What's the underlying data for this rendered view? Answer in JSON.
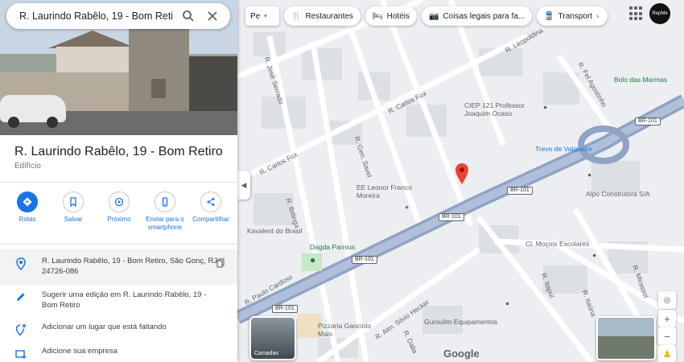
{
  "search": {
    "query": "R. Laurindo Rabêlo, 19 - Bom Retiro"
  },
  "place": {
    "title": "R. Laurindo Rabêlo, 19 - Bom Retiro",
    "category": "Edifício"
  },
  "actions": [
    {
      "label": "Rotas",
      "icon": "directions-icon"
    },
    {
      "label": "Salvar",
      "icon": "bookmark-icon"
    },
    {
      "label": "Próximo",
      "icon": "nearby-icon"
    },
    {
      "label": "Enviar para o smartphone",
      "icon": "send-to-phone-icon"
    },
    {
      "label": "Compartilhar",
      "icon": "share-icon"
    }
  ],
  "info": {
    "address": "R. Laurindo Rabêlo, 19 - Bom Retiro, São Gonç, RJ, 24726-086",
    "suggest_edit": "Sugerir uma edição em R. Laurindo Rabêlo, 19 - Bom Retiro",
    "add_place": "Adicionar um lugar que está faltando",
    "add_business": "Adicione sua empresa"
  },
  "chips": [
    "Pe",
    "Restaurantes",
    "Hotéis",
    "Coisas legais para fa...",
    "Transport"
  ],
  "map": {
    "layers_label": "Camadas",
    "logo": "Google",
    "streets": [
      "R. José Serrado",
      "R. Carlos Fox",
      "R. Gen. Savel",
      "R. Alm. Silvio Hecker",
      "R. Itapuí",
      "R. Itaúna",
      "R. Mirassol",
      "R. Fel Agostinho",
      "R. Ibitinga",
      "R. Dalia",
      "R. Paulo Cardoso",
      "R. Leopoldina"
    ],
    "pois": [
      "CIEP 121 Professor Joaquim Ocaso",
      "EE Leonor Franco Moreira",
      "Alpo Construtora S/A",
      "Dagda Parnius",
      "Cl. Moçois Escolares",
      "Pizzaria Ganciolo Mais",
      "Gurouilm Equipamentos",
      "Bolo das Marmas",
      "Kavalent do Brasil",
      "Trevo de Valqueire"
    ],
    "road_shields": [
      "BR-101",
      "BR-101",
      "BR-101",
      "BR-101",
      "BR-101"
    ],
    "avatar_text": "RepMe"
  }
}
